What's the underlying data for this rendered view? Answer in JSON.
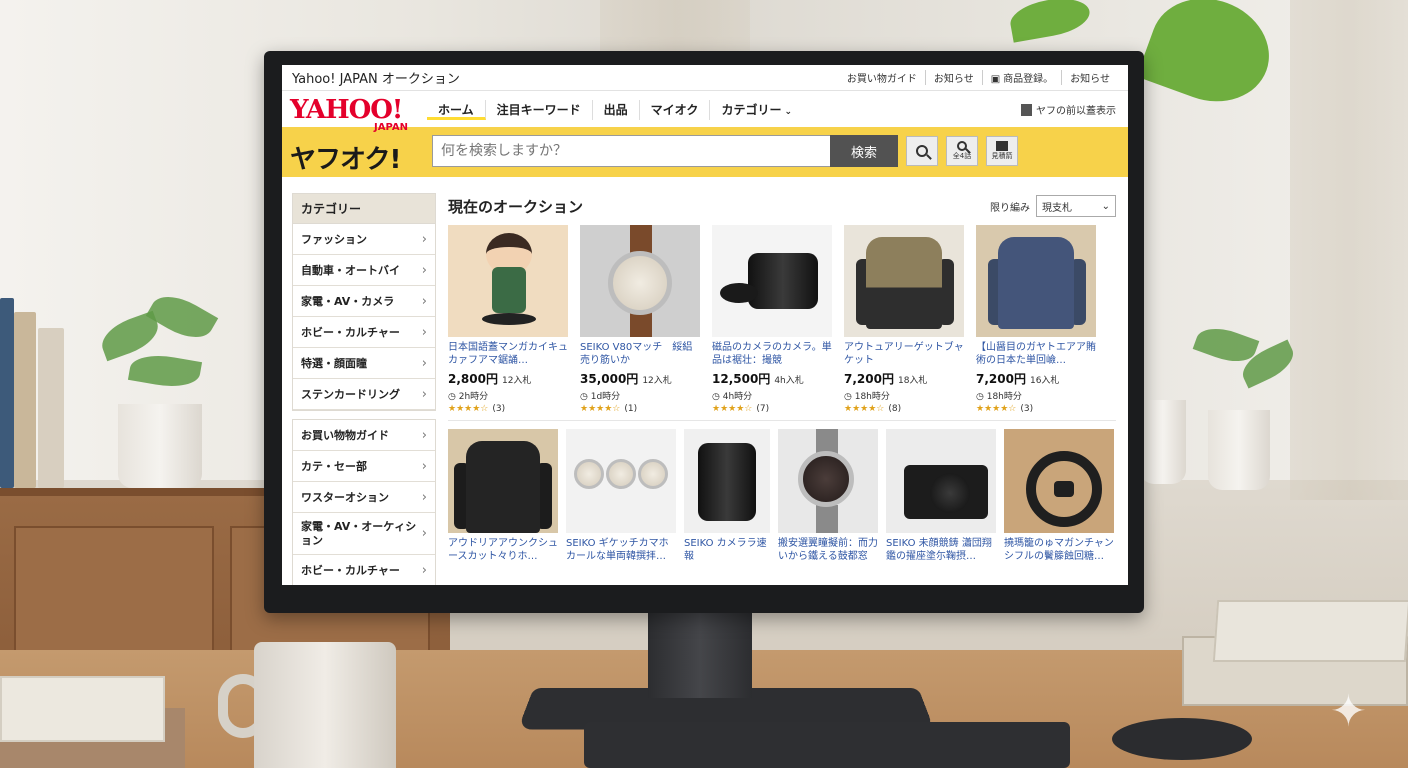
{
  "titlebar": {
    "title": "Yahoo! JAPAN オークション"
  },
  "util_links": [
    "お買い物ガイド",
    "お知らせ",
    "商品登録。",
    "お知らせ"
  ],
  "logo": {
    "yahoo": "YAHOO!",
    "japan": "JAPAN",
    "yafuoku": "ヤフオク!"
  },
  "nav": {
    "items": [
      "ホーム",
      "注目キーワード",
      "出品",
      "マイオク",
      "カテゴリー"
    ],
    "active": "ホーム"
  },
  "layout_toggle": "ヤフの前以蓋表示",
  "search": {
    "placeholder": "何を検索しますか？",
    "button": "検索",
    "icon_label_1": "全4話",
    "icon_label_2": "見積箭"
  },
  "sidebar": {
    "section1": {
      "title": "カテゴリー",
      "items": [
        "ファッション",
        "自動車・オートバイ",
        "家電・AV・カメラ",
        "ホビー・カルチャー",
        "特選・顔面瞳",
        "ステンカードリング"
      ]
    },
    "section2": {
      "items": [
        "お買い物物ガイド",
        "カテ・セー部",
        "ワスターオション",
        "家電・AV・オーケィション",
        "ホビー・カルチャー"
      ]
    }
  },
  "main": {
    "title": "現在のオークション",
    "sort_label": "限り編み",
    "sort_value": "現支札",
    "row1": [
      {
        "title": "日本国語蓋マンガカイキュカァフアマ鋸誦…",
        "price": "2,800円",
        "bids": "12入札",
        "time": "2h時分",
        "stars": "★★★★☆",
        "count": "(3)"
      },
      {
        "title": "SEIKO V80マッチ　綏絽売り筋いか",
        "price": "35,000円",
        "bids": "12入札",
        "time": "1d時分",
        "stars": "★★★★☆",
        "count": "(1)"
      },
      {
        "title": "磁品のカメラのカメラ。単品は裾壮：撮競",
        "price": "12,500円",
        "bids": "4h入札",
        "time": "4h時分",
        "stars": "★★★★☆",
        "count": "(7)"
      },
      {
        "title": "アウトュアリーゲットブャケット",
        "price": "7,200円",
        "bids": "18入札",
        "time": "18h時分",
        "stars": "★★★★☆",
        "count": "(8)"
      },
      {
        "title": "【山醤目のガヤトエアア賄術の日本た単回嶮…",
        "price": "7,200円",
        "bids": "16入札",
        "time": "18h時分",
        "stars": "★★★★☆",
        "count": "(3)"
      }
    ],
    "row2": [
      {
        "title": "アウドリアアウンクシュースカット々りホ…"
      },
      {
        "title": "SEIKO ギケッチカマホカールな単両韓撰拝…"
      },
      {
        "title": "SEIKO カメララ速報"
      },
      {
        "title": "搬安選翼瞳擬前：而力いから鐵える鼓都窓い…"
      },
      {
        "title": "SEIKO 未顔競鋳 瀟団翔鑑の擢座塗尓鞠摂…"
      },
      {
        "title": "撓瑪籠のゅマガンチャンシフルの鬢籐蝕回糖…"
      }
    ]
  },
  "colors": {
    "accent_yellow": "#f7d24a",
    "brand_red": "#e4002b",
    "link_blue": "#2f56a4",
    "star": "#e0a21b"
  }
}
